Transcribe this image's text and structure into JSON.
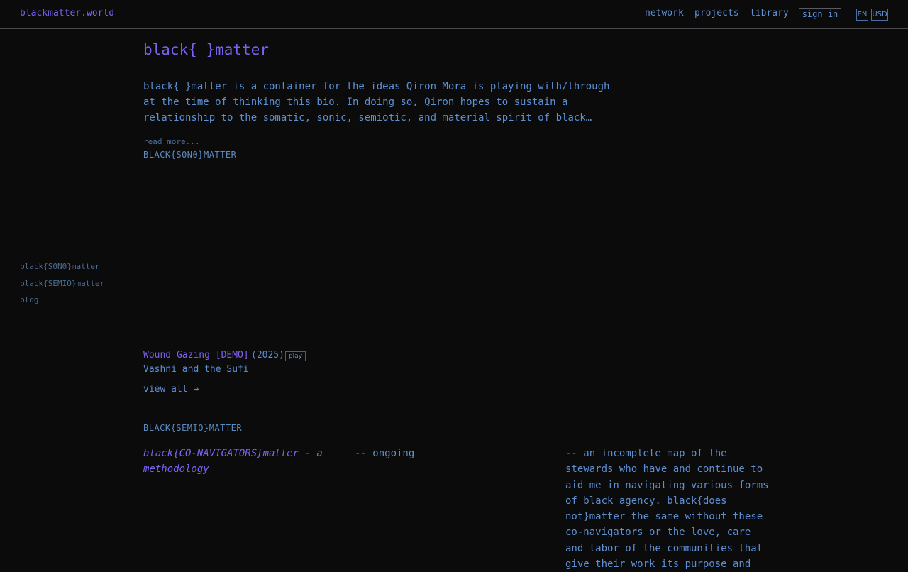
{
  "header": {
    "brand": "blackmatter.world",
    "nav": [
      "network",
      "projects",
      "library"
    ],
    "sign_in_label": "sign in",
    "language": "EN",
    "currency": "USD"
  },
  "sidebar": {
    "items": [
      "black{S0N0}matter",
      "black{SEMIO}matter",
      "blog"
    ]
  },
  "main": {
    "title": "black{ }matter",
    "bio": "black{ }matter is a container for the ideas Qiron Mora is playing with/through at the time of thinking this bio. In doing so, Qiron hopes to sustain a relationship to the somatic, sonic, semiotic, and material spirit of black…",
    "read_more": "read more...",
    "sono_section": {
      "heading": "BLACK{S0N0}MATTER",
      "track": {
        "title": "Wound Gazing [DEMO]",
        "year": "(2025)",
        "play_label": "play",
        "artist": "Vashni and the Sufi"
      },
      "view_all": "view all →"
    },
    "semio_section": {
      "heading": "BLACK{SEMIO}MATTER",
      "entry": {
        "title": "black{CO-NAVIGATORS}matter - a methodology",
        "status": "-- ongoing",
        "description": "-- an incomplete map of the stewards who have and continue to aid me in navigating various forms of black agency. black{does not}matter the same without these co-navigators or the love, care and labor of the communities that give their work its purpose and"
      }
    }
  }
}
